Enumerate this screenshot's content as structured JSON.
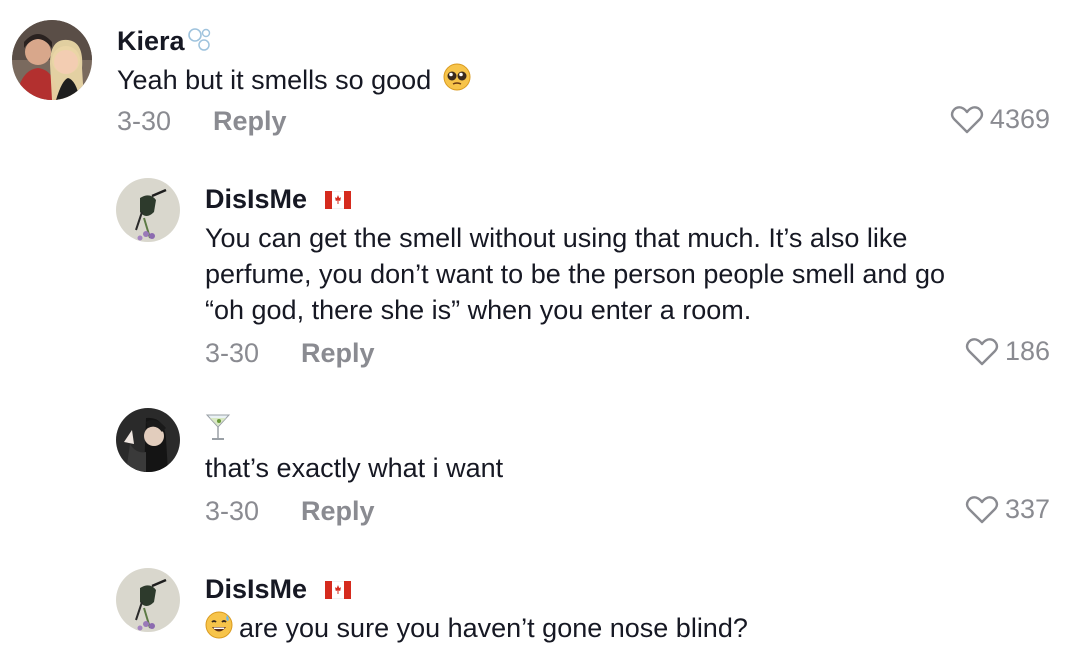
{
  "comments": [
    {
      "username": "Kiera",
      "text_lines": [
        "Yeah but it smells so good"
      ],
      "date": "3-30",
      "reply_label": "Reply",
      "likes": "4369"
    },
    {
      "username": "DisIsMe",
      "text_lines": [
        "You can get the smell without using that much. It’s also like",
        "perfume, you don’t want to be the person people smell and go",
        "“oh god, there she is” when you enter a room."
      ],
      "date": "3-30",
      "reply_label": "Reply",
      "likes": "186"
    },
    {
      "username": "",
      "text_lines": [
        "that’s exactly what i want"
      ],
      "date": "3-30",
      "reply_label": "Reply",
      "likes": "337"
    },
    {
      "username": "DisIsMe",
      "text_lines": [
        "are you sure you haven’t gone nose blind?"
      ]
    }
  ],
  "icons": {
    "like": "heart-outline-icon",
    "name_badge": "bubbles-icon",
    "flag": "canada-flag-icon",
    "cocktail": "cocktail-glass-icon",
    "pleading": "pleading-face-emoji",
    "sweat_smile": "grinning-sweat-emoji"
  },
  "colors": {
    "text": "#161823",
    "muted": "#8a8b91",
    "flag_red": "#d52b1e"
  }
}
